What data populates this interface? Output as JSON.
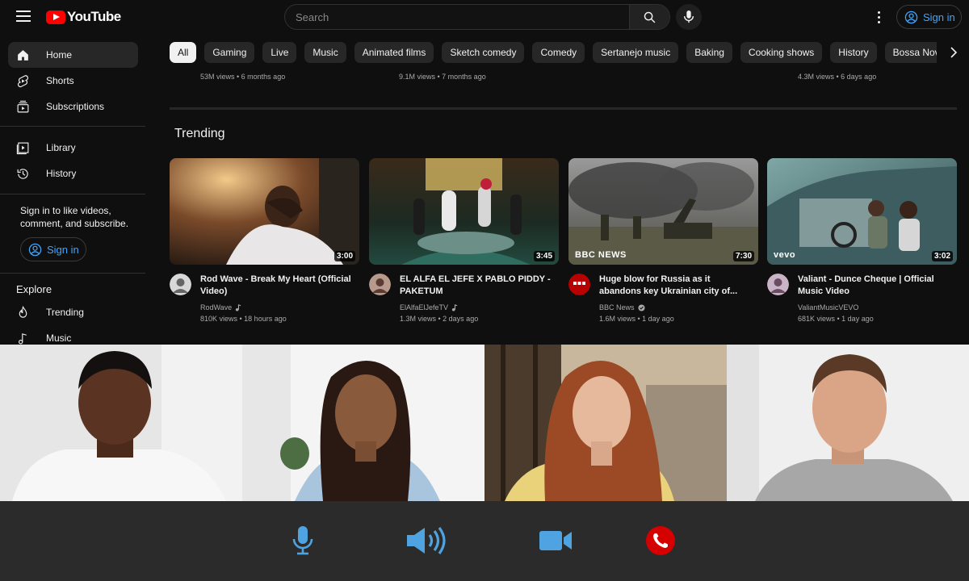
{
  "app": {
    "logo_text": "YouTube"
  },
  "header": {
    "search_placeholder": "Search",
    "signin_label": "Sign in"
  },
  "sidebar": {
    "items": [
      {
        "label": "Home",
        "icon": "home-icon",
        "active": true
      },
      {
        "label": "Shorts",
        "icon": "shorts-icon"
      },
      {
        "label": "Subscriptions",
        "icon": "subscriptions-icon"
      },
      {
        "label": "Library",
        "icon": "library-icon"
      },
      {
        "label": "History",
        "icon": "history-icon"
      }
    ],
    "signin_prompt": "Sign in to like videos, comment, and subscribe.",
    "signin_label": "Sign in",
    "explore_title": "Explore",
    "explore_items": [
      {
        "label": "Trending",
        "icon": "trending-icon"
      },
      {
        "label": "Music",
        "icon": "music-icon"
      }
    ]
  },
  "chips": [
    "All",
    "Gaming",
    "Live",
    "Music",
    "Animated films",
    "Sketch comedy",
    "Comedy",
    "Sertanejo music",
    "Baking",
    "Cooking shows",
    "History",
    "Bossa Nova"
  ],
  "previous_row_meta": [
    "53M views • 6 months ago",
    "9.1M views • 7 months ago",
    "4.3M views • 6 days ago"
  ],
  "trending": {
    "title": "Trending",
    "videos": [
      {
        "title": "Rod Wave - Break My Heart (Official Video)",
        "channel": "RodWave",
        "meta": "810K views • 18 hours ago",
        "duration": "3:00",
        "verified": "music-note-icon"
      },
      {
        "title": "EL ALFA EL JEFE X PABLO PIDDY - PAKETUM",
        "channel": "ElAlfaElJefeTV",
        "meta": "1.3M views • 2 days ago",
        "duration": "3:45",
        "verified": "music-note-icon"
      },
      {
        "title": "Huge blow for Russia as it abandons key Ukrainian city of...",
        "channel": "BBC News",
        "meta": "1.6M views • 1 day ago",
        "duration": "7:30",
        "verified": "check-badge-icon",
        "brand": "BBC NEWS"
      },
      {
        "title": "Valiant - Dunce Cheque | Official Music Video",
        "channel": "ValiantMusicVEVO",
        "meta": "681K views • 1 day ago",
        "duration": "3:02",
        "brand": "vevo"
      }
    ]
  },
  "call": {
    "participants": 4,
    "controls": [
      "microphone-icon",
      "speaker-icon",
      "camera-icon",
      "end-call-icon"
    ],
    "colors": {
      "accent": "#4fa3e0",
      "end_call": "#d50000",
      "bar": "#2b2b2b"
    }
  }
}
